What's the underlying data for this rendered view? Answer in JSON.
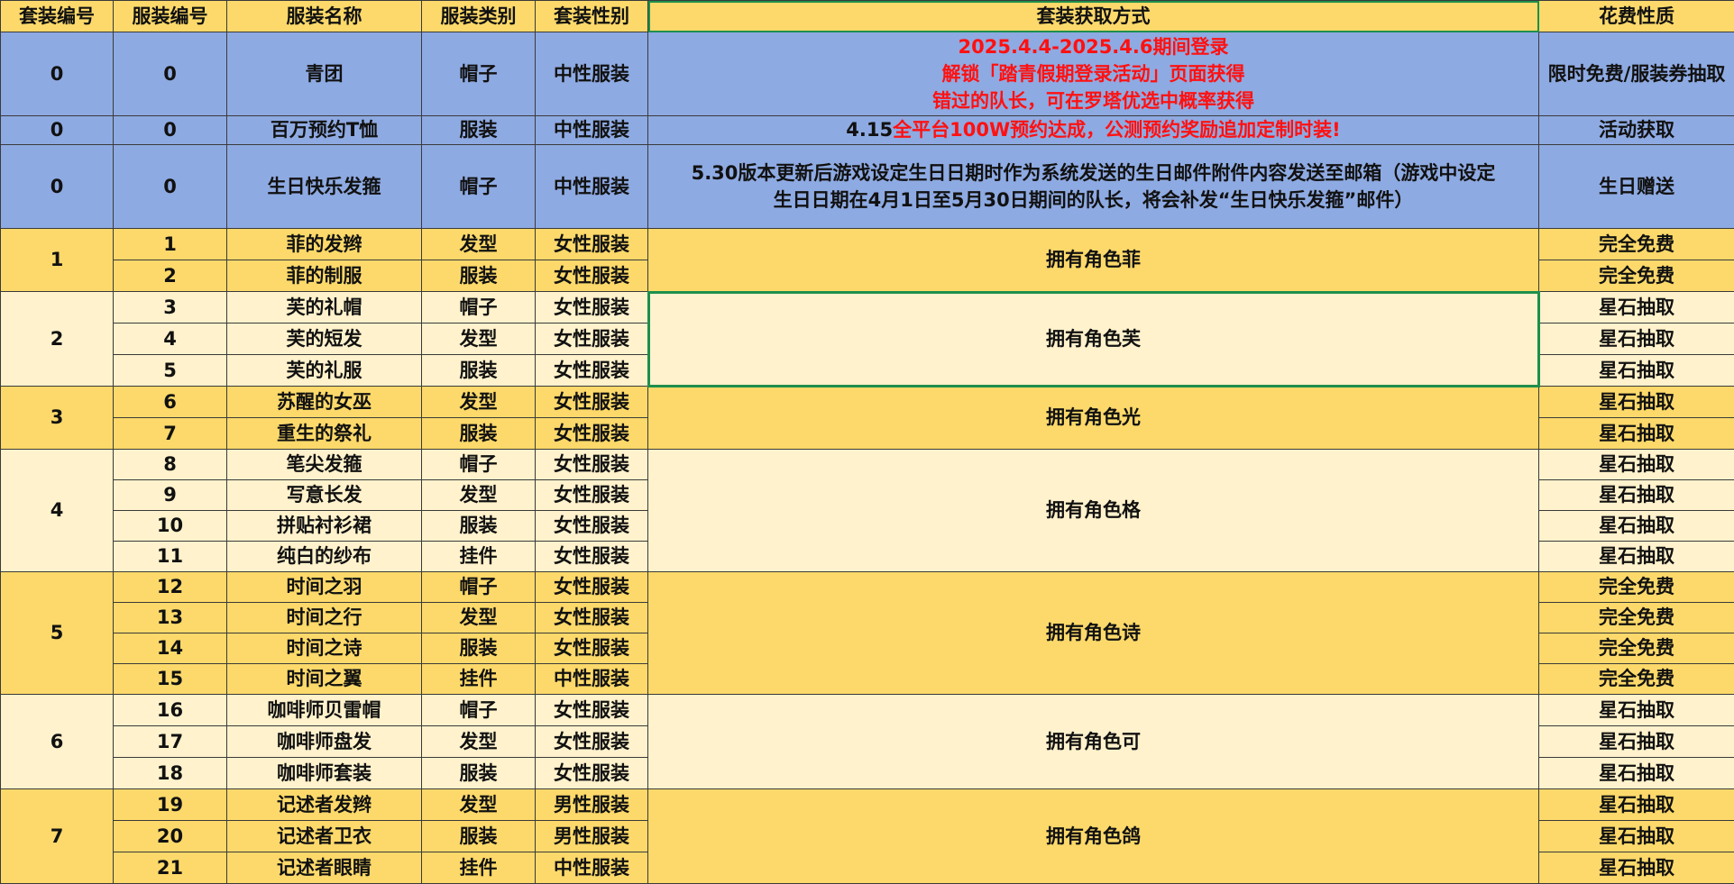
{
  "headers": [
    "套装编号",
    "服装编号",
    "服装名称",
    "服装类别",
    "套装性别",
    "套装获取方式",
    "花费性质"
  ],
  "special_rows": [
    {
      "suit": "0",
      "item": "0",
      "name": "青团",
      "category": "帽子",
      "gender": "中性服装",
      "method_lines": [
        "2025.4.4-2025.4.6期间登录",
        "解锁「踏青假期登录活动」页面获得",
        "错过的队长，可在罗塔优选中概率获得"
      ],
      "cost": "限时免费/服装券抽取"
    },
    {
      "suit": "0",
      "item": "0",
      "name": "百万预约T恤",
      "category": "服装",
      "gender": "中性服装",
      "method_prefix": "4.15",
      "method_red": "全平台100W预约达成，公测预约奖励追加定制时装!",
      "cost": "活动获取"
    },
    {
      "suit": "0",
      "item": "0",
      "name": "生日快乐发箍",
      "category": "帽子",
      "gender": "中性服装",
      "method_text": "5.30版本更新后游戏设定生日日期时作为系统发送的生日邮件附件内容发送至邮箱（游戏中设定生日日期在4月1日至5月30日期间的队长，将会补发“生日快乐发箍”邮件）",
      "cost": "生日赠送"
    }
  ],
  "suits": [
    {
      "suit": "1",
      "method": "拥有角色菲",
      "items": [
        {
          "item": "1",
          "name": "菲的发辫",
          "category": "发型",
          "gender": "女性服装",
          "cost": "完全免费"
        },
        {
          "item": "2",
          "name": "菲的制服",
          "category": "服装",
          "gender": "女性服装",
          "cost": "完全免费"
        }
      ]
    },
    {
      "suit": "2",
      "method": "拥有角色芙",
      "items": [
        {
          "item": "3",
          "name": "芙的礼帽",
          "category": "帽子",
          "gender": "女性服装",
          "cost": "星石抽取"
        },
        {
          "item": "4",
          "name": "芙的短发",
          "category": "发型",
          "gender": "女性服装",
          "cost": "星石抽取"
        },
        {
          "item": "5",
          "name": "芙的礼服",
          "category": "服装",
          "gender": "女性服装",
          "cost": "星石抽取"
        }
      ]
    },
    {
      "suit": "3",
      "method": "拥有角色光",
      "items": [
        {
          "item": "6",
          "name": "苏醒的女巫",
          "category": "发型",
          "gender": "女性服装",
          "cost": "星石抽取"
        },
        {
          "item": "7",
          "name": "重生的祭礼",
          "category": "服装",
          "gender": "女性服装",
          "cost": "星石抽取"
        }
      ]
    },
    {
      "suit": "4",
      "method": "拥有角色格",
      "items": [
        {
          "item": "8",
          "name": "笔尖发箍",
          "category": "帽子",
          "gender": "女性服装",
          "cost": "星石抽取"
        },
        {
          "item": "9",
          "name": "写意长发",
          "category": "发型",
          "gender": "女性服装",
          "cost": "星石抽取"
        },
        {
          "item": "10",
          "name": "拼贴衬衫裙",
          "category": "服装",
          "gender": "女性服装",
          "cost": "星石抽取"
        },
        {
          "item": "11",
          "name": "纯白的纱布",
          "category": "挂件",
          "gender": "女性服装",
          "cost": "星石抽取"
        }
      ]
    },
    {
      "suit": "5",
      "method": "拥有角色诗",
      "items": [
        {
          "item": "12",
          "name": "时间之羽",
          "category": "帽子",
          "gender": "女性服装",
          "cost": "完全免费"
        },
        {
          "item": "13",
          "name": "时间之行",
          "category": "发型",
          "gender": "女性服装",
          "cost": "完全免费"
        },
        {
          "item": "14",
          "name": "时间之诗",
          "category": "服装",
          "gender": "女性服装",
          "cost": "完全免费"
        },
        {
          "item": "15",
          "name": "时间之翼",
          "category": "挂件",
          "gender": "中性服装",
          "cost": "完全免费"
        }
      ]
    },
    {
      "suit": "6",
      "method": "拥有角色可",
      "items": [
        {
          "item": "16",
          "name": "咖啡师贝雷帽",
          "category": "帽子",
          "gender": "女性服装",
          "cost": "星石抽取"
        },
        {
          "item": "17",
          "name": "咖啡师盘发",
          "category": "发型",
          "gender": "女性服装",
          "cost": "星石抽取"
        },
        {
          "item": "18",
          "name": "咖啡师套装",
          "category": "服装",
          "gender": "女性服装",
          "cost": "星石抽取"
        }
      ]
    },
    {
      "suit": "7",
      "method": "拥有角色鸽",
      "items": [
        {
          "item": "19",
          "name": "记述者发辫",
          "category": "发型",
          "gender": "男性服装",
          "cost": "星石抽取"
        },
        {
          "item": "20",
          "name": "记述者卫衣",
          "category": "服装",
          "gender": "男性服装",
          "cost": "星石抽取"
        },
        {
          "item": "21",
          "name": "记述者眼睛",
          "category": "挂件",
          "gender": "中性服装",
          "cost": "星石抽取"
        }
      ]
    }
  ],
  "colors": {
    "header": "#fcd96a",
    "blue_row": "#8eaae2",
    "gold_band": "#fcd96a",
    "cream_band": "#fff2cc",
    "red_text": "#ff1111",
    "selection": "#1e8f4c"
  }
}
